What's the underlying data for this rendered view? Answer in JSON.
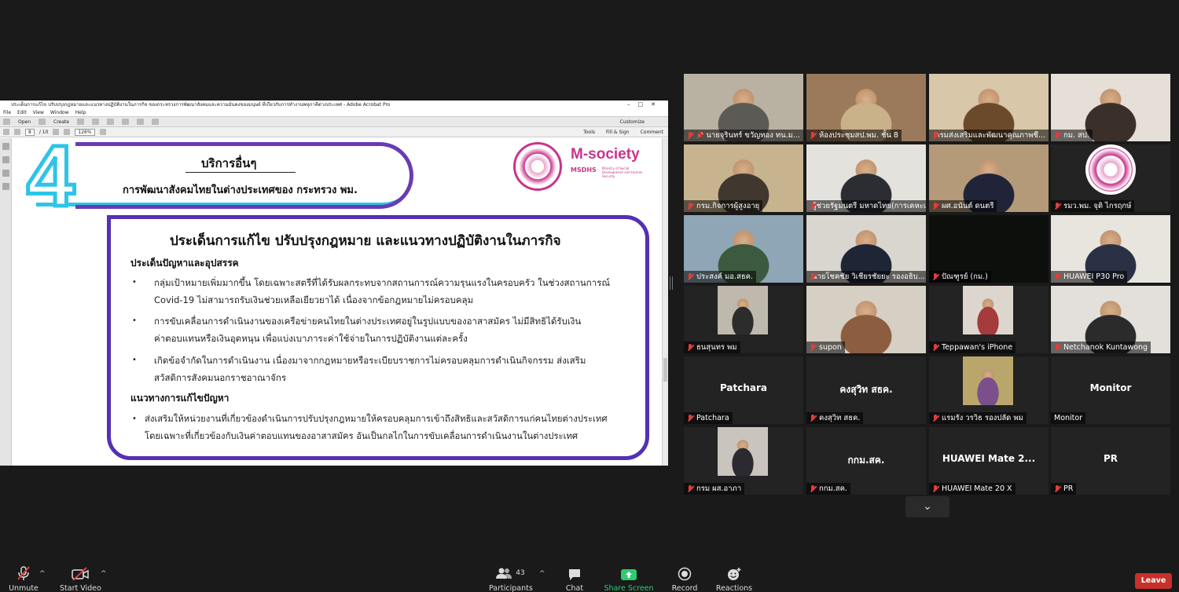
{
  "acrobat": {
    "title": "ประเด็นการแก้ไข ปรับปรุงกฎหมายและแนวทางปฏิบัติงานในภารกิจ ของกระทรวงการพัฒนาสังคมและความมั่นคงของมนุษย์ ที่เกี่ยวกับการทำงานพหุภาคีต่างประเทศ - Adobe Acrobat Pro",
    "menu": [
      "File",
      "Edit",
      "View",
      "Window",
      "Help"
    ],
    "open_label": "Open",
    "create_label": "Create",
    "customize_label": "Customize",
    "page_current": "8",
    "page_total": "/ 10",
    "zoom": "126%",
    "tools_label": "Tools",
    "fill_sign_label": "Fill & Sign",
    "comment_label": "Comment"
  },
  "slide": {
    "number": "4",
    "header_title": "บริการอื่นๆ",
    "header_sub": "การพัฒนาสังคมไทยในต่างประเทศของ กระทรวง พม.",
    "logo_text": "M-society",
    "logo_sub": "MSDHS",
    "logo_small": "Ministry of Social Development and Human Security",
    "main_title": "ประเด็นการแก้ไข ปรับปรุงกฎหมาย และแนวทางปฏิบัติงานในภารกิจ",
    "section1": "ประเด็นปัญหาและอุปสรรค",
    "bullets1": [
      {
        "l1": "กลุ่มเป้าหมายเพิ่มมากขึ้น โดยเฉพาะสตรีที่ได้รับผลกระทบจากสถานการณ์ความรุนแรงในครอบครัว ในช่วงสถานการณ์",
        "l2": "Covid-19 ไม่สามารถรับเงินช่วยเหลือเยียวยาได้ เนื่องจากข้อกฎหมายไม่ครอบคลุม"
      },
      {
        "l1": "การขับเคลื่อนการดำเนินงานของเครือข่ายคนไทยในต่างประเทศอยู่ในรูปแบบของอาสาสมัคร ไม่มีสิทธิได้รับเงิน",
        "l2": "ค่าตอบแทนหรือเงินอุดหนุน เพื่อแบ่งเบาภาระค่าใช้จ่ายในการปฏิบัติงานแต่ละครั้ง"
      },
      {
        "l1": "เกิดข้อจำกัดในการดำเนินงาน เนื่องมาจากกฎหมายหรือระเบียบราชการไม่ครอบคลุมการดำเนินกิจกรรม ส่งเสริม",
        "l2": "สวัสดิการสังคมนอกราชอาณาจักร"
      }
    ],
    "section2": "แนวทางการแก้ไขปัญหา",
    "bullets2": [
      {
        "l1": "ส่งเสริมให้หน่วยงานที่เกี่ยวข้องดำเนินการปรับปรุงกฎหมายให้ครอบคลุมการเข้าถึงสิทธิและสวัสดิการแก่คนไทยต่างประเทศ",
        "l2": "โดยเฉพาะที่เกี่ยวข้องกับเงินค่าตอบแทนของอาสาสมัคร อันเป็นกลไกในการขับเคลื่อนการดำเนินงานในต่างประเทศ"
      }
    ]
  },
  "participants": [
    {
      "name": "นายจุรินทร์ ขวัญทอง ทน.ม...",
      "video": true,
      "pinned": true,
      "colors": [
        "#b9b2a3",
        "#5b5a55"
      ]
    },
    {
      "name": "ห้องประชุมสป.พม. ชั้น 8",
      "video": true,
      "colors": [
        "#9a7a5a",
        "#c9b18a"
      ]
    },
    {
      "name": "กรมส่งเสริมและพัฒนาคุณภาพชี...",
      "video": true,
      "colors": [
        "#d8c7a8",
        "#6b4a2b"
      ]
    },
    {
      "name": "กม. สป.",
      "video": true,
      "colors": [
        "#e6dfd8",
        "#3b2f2a"
      ]
    },
    {
      "name": "กรม.กิจการผู้สูงอายุ",
      "video": true,
      "colors": [
        "#c7b48f",
        "#40382f"
      ]
    },
    {
      "name": "ผู้ช่วยรัฐมนตรี มหาดไทย(การเคหะแห่...",
      "video": true,
      "colors": [
        "#e4e2dc",
        "#2b2d33"
      ]
    },
    {
      "name": "ผศ.อนันต์ ดนตรี",
      "video": true,
      "colors": [
        "#b49a78",
        "#1f2438"
      ]
    },
    {
      "name": "รมว.พม. จุติ ไกรฤกษ์",
      "video": false,
      "seal": true
    },
    {
      "name": "ประสงค์ มอ.สธค.",
      "video": true,
      "colors": [
        "#8fa6b6",
        "#3c5a3f"
      ]
    },
    {
      "name": "นายโชคชัย วิเชียรชัยยะ รองอธิบ...",
      "video": true,
      "colors": [
        "#d9d6cf",
        "#1e2535"
      ]
    },
    {
      "name": "ปัณฑูรย์ (กม.)",
      "video": true,
      "dark": true,
      "colors": [
        "#0d0f0d",
        "#111"
      ]
    },
    {
      "name": "HUAWEI P30 Pro",
      "video": true,
      "colors": [
        "#e8e4de",
        "#2a3145"
      ]
    },
    {
      "name": "ธนสุนทร พม",
      "video": true,
      "colors": [
        "#bfb8ad",
        "#2c2c2c"
      ]
    },
    {
      "name": "supon",
      "video": true,
      "colors": [
        "#d6cfc3",
        "#8d5d3f"
      ]
    },
    {
      "name": "Teppawan's iPhone",
      "video": true,
      "colors": [
        "#dcd6cf",
        "#a53b3b"
      ]
    },
    {
      "name": "Netchanok Kuntawong",
      "video": true,
      "colors": [
        "#e3e0db",
        "#2b2b2b"
      ]
    },
    {
      "name": "Patchara",
      "video": false,
      "center": "Patchara"
    },
    {
      "name": "คงสุวิท สธค.",
      "video": false,
      "center": "คงสุวิท สธค."
    },
    {
      "name": "แรมรัง วรวิธ รองปลัด พม",
      "video": true,
      "colors": [
        "#b8a66b",
        "#7a4f8c"
      ]
    },
    {
      "name": "Monitor",
      "video": false,
      "center": "Monitor",
      "nomic": true
    },
    {
      "name": "กรม ผส.อาภา",
      "video": true,
      "colors": [
        "#c9c4be",
        "#2a2a30"
      ]
    },
    {
      "name": "กกม.สค.",
      "video": false,
      "center": "กกม.สค."
    },
    {
      "name": "HUAWEI Mate 20 X",
      "video": false,
      "center": "HUAWEI Mate 2..."
    },
    {
      "name": "PR",
      "video": false,
      "center": "PR"
    }
  ],
  "toolbar": {
    "unmute": "Unmute",
    "start_video": "Start Video",
    "participants": "Participants",
    "participants_count": "43",
    "chat": "Chat",
    "share_screen": "Share Screen",
    "record": "Record",
    "reactions": "Reactions",
    "leave": "Leave"
  },
  "colors": {
    "background": "#1a1a1a",
    "leave": "#c8302b",
    "share_green": "#2ecc71",
    "mic_red": "#e03d3d"
  }
}
